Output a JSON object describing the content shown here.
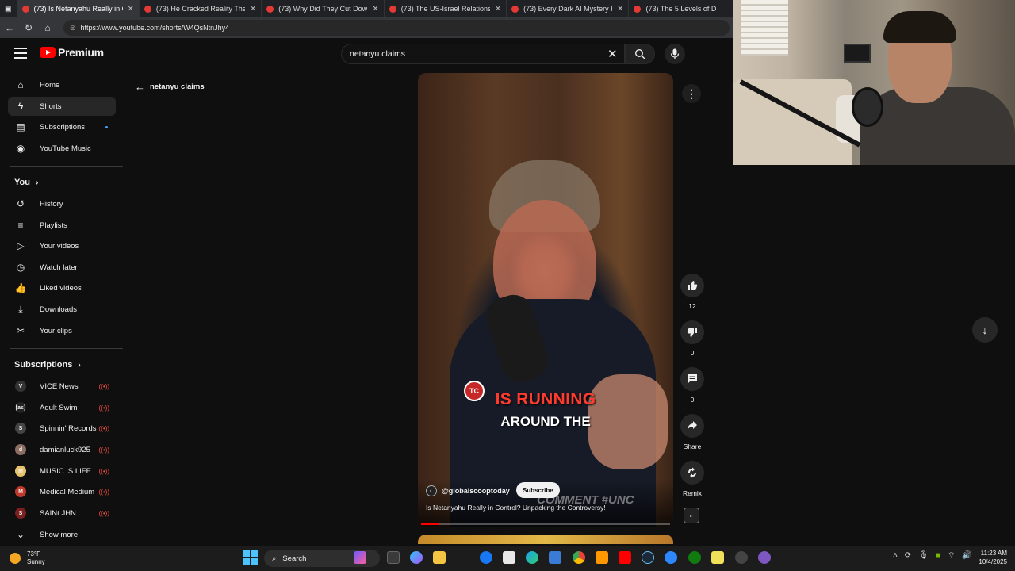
{
  "browser": {
    "tabs": [
      {
        "title": "(73) Is Netanyahu Really in C",
        "active": true
      },
      {
        "title": "(73) He Cracked Reality Then CIA",
        "active": false
      },
      {
        "title": "(73) Why Did They Cut Down All",
        "active": false
      },
      {
        "title": "(73) The US-Israel Relationship is",
        "active": false
      },
      {
        "title": "(73) Every Dark AI Mystery Happe",
        "active": false
      },
      {
        "title": "(73) The 5 Levels of D",
        "active": false
      }
    ],
    "url": "https://www.youtube.com/shorts/W4QsNtnJhy4"
  },
  "header": {
    "logo_text": "Premium",
    "search_value": "netanyu claims"
  },
  "sidebar": {
    "main": [
      {
        "label": "Home",
        "icon": "home-icon",
        "glyph": "⌂"
      },
      {
        "label": "Shorts",
        "icon": "shorts-icon",
        "glyph": "ϟ",
        "active": true
      },
      {
        "label": "Subscriptions",
        "icon": "subscriptions-icon",
        "glyph": "▤",
        "dot": true
      },
      {
        "label": "YouTube Music",
        "icon": "music-icon",
        "glyph": "◉"
      }
    ],
    "you_heading": "You",
    "you": [
      {
        "label": "History",
        "icon": "history-icon",
        "glyph": "↺"
      },
      {
        "label": "Playlists",
        "icon": "playlists-icon",
        "glyph": "≡"
      },
      {
        "label": "Your videos",
        "icon": "your-videos-icon",
        "glyph": "▷"
      },
      {
        "label": "Watch later",
        "icon": "clock-icon",
        "glyph": "◷"
      },
      {
        "label": "Liked videos",
        "icon": "thumbs-up-icon",
        "glyph": "👍"
      },
      {
        "label": "Downloads",
        "icon": "download-icon",
        "glyph": "⤓"
      },
      {
        "label": "Your clips",
        "icon": "scissors-icon",
        "glyph": "✂"
      }
    ],
    "subs_heading": "Subscriptions",
    "subs": [
      {
        "label": "VICE News",
        "avatar": "V",
        "color": "#333333"
      },
      {
        "label": "Adult Swim",
        "avatar": "[as]",
        "color": "#222222"
      },
      {
        "label": "Spinnin' Records",
        "avatar": "S",
        "color": "#444444"
      },
      {
        "label": "damianluck925",
        "avatar": "d",
        "color": "#8d6e63"
      },
      {
        "label": "MUSIC IS LIFE",
        "avatar": "M",
        "color": "#e6c36a"
      },
      {
        "label": "Medical Medium",
        "avatar": "M",
        "color": "#c0392b"
      },
      {
        "label": "SAINt JHN",
        "avatar": "S",
        "color": "#7b1f1f"
      }
    ],
    "show_more": "Show more"
  },
  "back_search": "netanyu claims",
  "short": {
    "caption_line1": "IS RUNNING",
    "caption_line2": "AROUND THE",
    "tc_badge": "TC",
    "overlay_text": "COMMENT  #UNC",
    "channel": "@globalscooptoday",
    "subscribe": "Subscribe",
    "title": "Is Netanyahu Really in Control? Unpacking the Controversy!",
    "progress": 0.07,
    "likes": "12",
    "dislikes": "0",
    "comments": "0",
    "share": "Share",
    "remix": "Remix"
  },
  "taskbar": {
    "temp": "73°F",
    "condition": "Sunny",
    "search": "Search",
    "time": "11:23 AM",
    "date": "10/4/2025"
  }
}
